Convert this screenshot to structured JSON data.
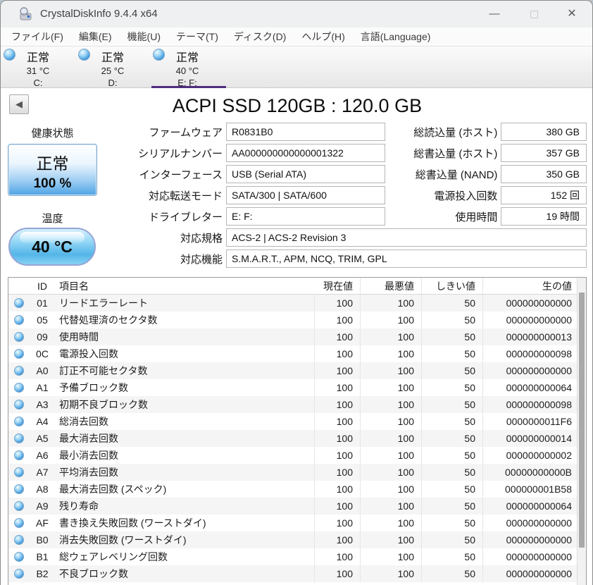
{
  "window": {
    "title": "CrystalDiskInfo 9.4.4 x64",
    "minimize_icon": "—",
    "maximize_icon": "□",
    "close_icon": "✕",
    "back_icon": "◀"
  },
  "colors": {
    "accent_purple": "#4f2d7f",
    "health_blue": "#4da3e4",
    "orb_blue": "#4a9fe0",
    "titlebar_gray": "#eef0f1"
  },
  "menu": {
    "items": [
      "ファイル(F)",
      "編集(E)",
      "機能(U)",
      "テーマ(T)",
      "ディスク(D)",
      "ヘルプ(H)",
      "言語(Language)"
    ]
  },
  "drive_tabs": [
    {
      "status": "正常",
      "temp": "31 °C",
      "letter": "C:",
      "selected": false
    },
    {
      "status": "正常",
      "temp": "25 °C",
      "letter": "D:",
      "selected": false
    },
    {
      "status": "正常",
      "temp": "40 °C",
      "letter": "E: F:",
      "selected": true
    }
  ],
  "drive": {
    "title": "ACPI SSD 120GB : 120.0 GB",
    "health": {
      "label": "健康状態",
      "status": "正常",
      "percent": "100 %"
    },
    "temperature": {
      "label": "温度",
      "value": "40 °C"
    },
    "fields_left": [
      {
        "label": "ファームウェア",
        "value": "R0831B0"
      },
      {
        "label": "シリアルナンバー",
        "value": "AA000000000000001322"
      },
      {
        "label": "インターフェース",
        "value": "USB (Serial ATA)"
      },
      {
        "label": "対応転送モード",
        "value": "SATA/300 | SATA/600"
      },
      {
        "label": "ドライブレター",
        "value": "E: F:"
      }
    ],
    "fields_right": [
      {
        "label": "総読込量 (ホスト)",
        "value": "380 GB"
      },
      {
        "label": "総書込量 (ホスト)",
        "value": "357 GB"
      },
      {
        "label": "総書込量 (NAND)",
        "value": "350 GB"
      },
      {
        "label": "電源投入回数",
        "value": "152 回"
      },
      {
        "label": "使用時間",
        "value": "19 時間"
      }
    ],
    "fields_wide": [
      {
        "label": "対応規格",
        "value": "ACS-2 | ACS-2 Revision 3"
      },
      {
        "label": "対応機能",
        "value": "S.M.A.R.T., APM, NCQ, TRIM, GPL"
      }
    ]
  },
  "smart_table": {
    "headers": {
      "id": "ID",
      "name": "項目名",
      "current": "現在値",
      "worst": "最悪値",
      "threshold": "しきい値",
      "raw": "生の値"
    },
    "rows": [
      {
        "id": "01",
        "name": "リードエラーレート",
        "current": "100",
        "worst": "100",
        "threshold": "50",
        "raw": "000000000000"
      },
      {
        "id": "05",
        "name": "代替処理済のセクタ数",
        "current": "100",
        "worst": "100",
        "threshold": "50",
        "raw": "000000000000"
      },
      {
        "id": "09",
        "name": "使用時間",
        "current": "100",
        "worst": "100",
        "threshold": "50",
        "raw": "000000000013"
      },
      {
        "id": "0C",
        "name": "電源投入回数",
        "current": "100",
        "worst": "100",
        "threshold": "50",
        "raw": "000000000098"
      },
      {
        "id": "A0",
        "name": "訂正不可能セクタ数",
        "current": "100",
        "worst": "100",
        "threshold": "50",
        "raw": "000000000000"
      },
      {
        "id": "A1",
        "name": "予備ブロック数",
        "current": "100",
        "worst": "100",
        "threshold": "50",
        "raw": "000000000064"
      },
      {
        "id": "A3",
        "name": "初期不良ブロック数",
        "current": "100",
        "worst": "100",
        "threshold": "50",
        "raw": "000000000098"
      },
      {
        "id": "A4",
        "name": "総消去回数",
        "current": "100",
        "worst": "100",
        "threshold": "50",
        "raw": "0000000011F6"
      },
      {
        "id": "A5",
        "name": "最大消去回数",
        "current": "100",
        "worst": "100",
        "threshold": "50",
        "raw": "000000000014"
      },
      {
        "id": "A6",
        "name": "最小消去回数",
        "current": "100",
        "worst": "100",
        "threshold": "50",
        "raw": "000000000002"
      },
      {
        "id": "A7",
        "name": "平均消去回数",
        "current": "100",
        "worst": "100",
        "threshold": "50",
        "raw": "00000000000B"
      },
      {
        "id": "A8",
        "name": "最大消去回数 (スペック)",
        "current": "100",
        "worst": "100",
        "threshold": "50",
        "raw": "000000001B58"
      },
      {
        "id": "A9",
        "name": "残り寿命",
        "current": "100",
        "worst": "100",
        "threshold": "50",
        "raw": "000000000064"
      },
      {
        "id": "AF",
        "name": "書き換え失敗回数 (ワーストダイ)",
        "current": "100",
        "worst": "100",
        "threshold": "50",
        "raw": "000000000000"
      },
      {
        "id": "B0",
        "name": "消去失敗回数 (ワーストダイ)",
        "current": "100",
        "worst": "100",
        "threshold": "50",
        "raw": "000000000000"
      },
      {
        "id": "B1",
        "name": "総ウェアレベリング回数",
        "current": "100",
        "worst": "100",
        "threshold": "50",
        "raw": "000000000000"
      },
      {
        "id": "B2",
        "name": "不良ブロック数",
        "current": "100",
        "worst": "100",
        "threshold": "50",
        "raw": "000000000000"
      }
    ]
  }
}
